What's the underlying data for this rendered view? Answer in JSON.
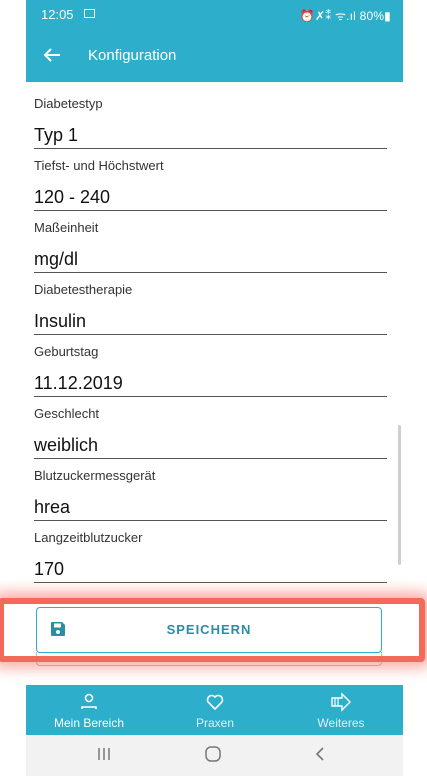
{
  "statusbar": {
    "time": "12:05",
    "right": "⏰✗⁑ ᯤ.ıl 80%▮"
  },
  "appbar": {
    "title": "Konfiguration"
  },
  "fields": [
    {
      "label": "Diabetestyp",
      "value": "Typ 1"
    },
    {
      "label": "Tiefst- und Höchstwert",
      "value": "120 - 240"
    },
    {
      "label": "Maßeinheit",
      "value": "mg/dl"
    },
    {
      "label": "Diabetestherapie",
      "value": "Insulin"
    },
    {
      "label": "Geburtstag",
      "value": "11.12.2019"
    },
    {
      "label": "Geschlecht",
      "value": "weiblich"
    },
    {
      "label": "Blutzuckermessgerät",
      "value": "hrea"
    },
    {
      "label": "Langzeitblutzucker",
      "value": "170"
    }
  ],
  "save": {
    "label": "SPEICHERN"
  },
  "bottomnav": {
    "items": [
      {
        "label": "Mein Bereich",
        "icon": "person-icon"
      },
      {
        "label": "Praxen",
        "icon": "heart-icon"
      },
      {
        "label": "Weiteres",
        "icon": "arrow-box-icon"
      }
    ]
  },
  "colors": {
    "primary": "#2daecb",
    "highlight": "#f46a5a",
    "save_text": "#2a8da6"
  }
}
